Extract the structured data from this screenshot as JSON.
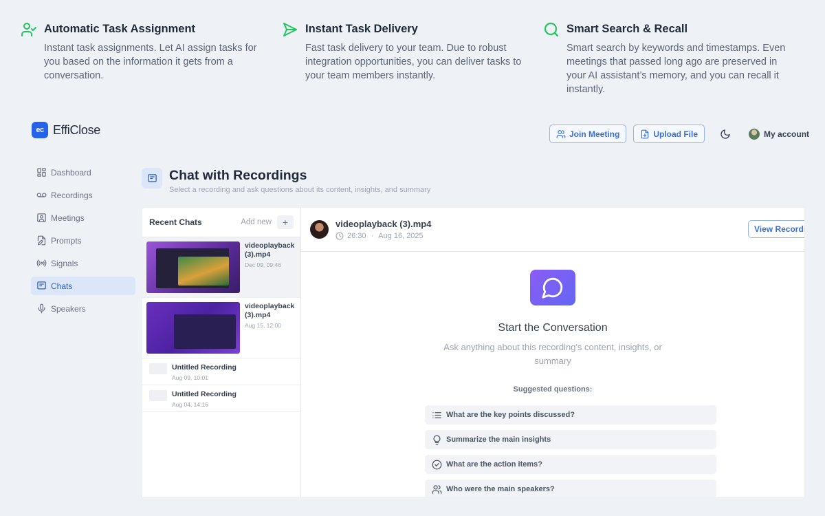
{
  "features": [
    {
      "title": "Automatic Task Assignment",
      "text": "Instant task assignments. Let AI assign tasks for you based on the information it gets from a conversation."
    },
    {
      "title": "Instant Task Delivery",
      "text": "Fast task delivery to your team. Due to robust integration opportunities, you can deliver tasks to your team members instantly."
    },
    {
      "title": "Smart Search & Recall",
      "text": "Smart search by keywords and timestamps. Even meetings that passed long ago are preserved in your AI assistant’s memory, and you can recall it instantly."
    }
  ],
  "brand": {
    "mark": "ec",
    "name": "EffiClose",
    "accent": "#2563eb"
  },
  "topbar": {
    "join_label": "Join Meeting",
    "upload_label": "Upload File",
    "account_label": "My account"
  },
  "sidebar": {
    "items": [
      {
        "label": "Dashboard",
        "icon": "grid-icon"
      },
      {
        "label": "Recordings",
        "icon": "voicemail-icon"
      },
      {
        "label": "Meetings",
        "icon": "user-square-icon"
      },
      {
        "label": "Prompts",
        "icon": "file-edit-icon"
      },
      {
        "label": "Signals",
        "icon": "radio-icon"
      },
      {
        "label": "Chats",
        "icon": "chat-icon"
      },
      {
        "label": "Speakers",
        "icon": "mic-icon"
      }
    ]
  },
  "page": {
    "title": "Chat with Recordings",
    "subtitle": "Select a recording and ask questions about its content, insights, and summary"
  },
  "recent": {
    "title": "Recent Chats",
    "add_label": "Add new",
    "plus": "+",
    "items": [
      {
        "name": "videoplayback (3).mp4",
        "date": "Dec 09, 09:46"
      },
      {
        "name": "videoplayback (3).mp4",
        "date": "Aug 15, 12:00"
      },
      {
        "name": "Untitled Recording",
        "date": "Aug 09, 10:01"
      },
      {
        "name": "Untitled Recording",
        "date": "Aug 04, 14:16"
      }
    ]
  },
  "current": {
    "file": "videoplayback (3).mp4",
    "duration": "26:30",
    "sep": "·",
    "date": "Aug 16, 2025",
    "view_label": "View Recording"
  },
  "conversation": {
    "title": "Start the Conversation",
    "desc": "Ask anything about this recording's content, insights, or summary",
    "suggested_label": "Suggested questions:",
    "questions": [
      {
        "text": "What are the key points discussed?",
        "icon": "list-icon"
      },
      {
        "text": "Summarize the main insights",
        "icon": "lightbulb-icon"
      },
      {
        "text": "What are the action items?",
        "icon": "check-circle-icon"
      },
      {
        "text": "Who were the main speakers?",
        "icon": "users-icon"
      }
    ]
  }
}
